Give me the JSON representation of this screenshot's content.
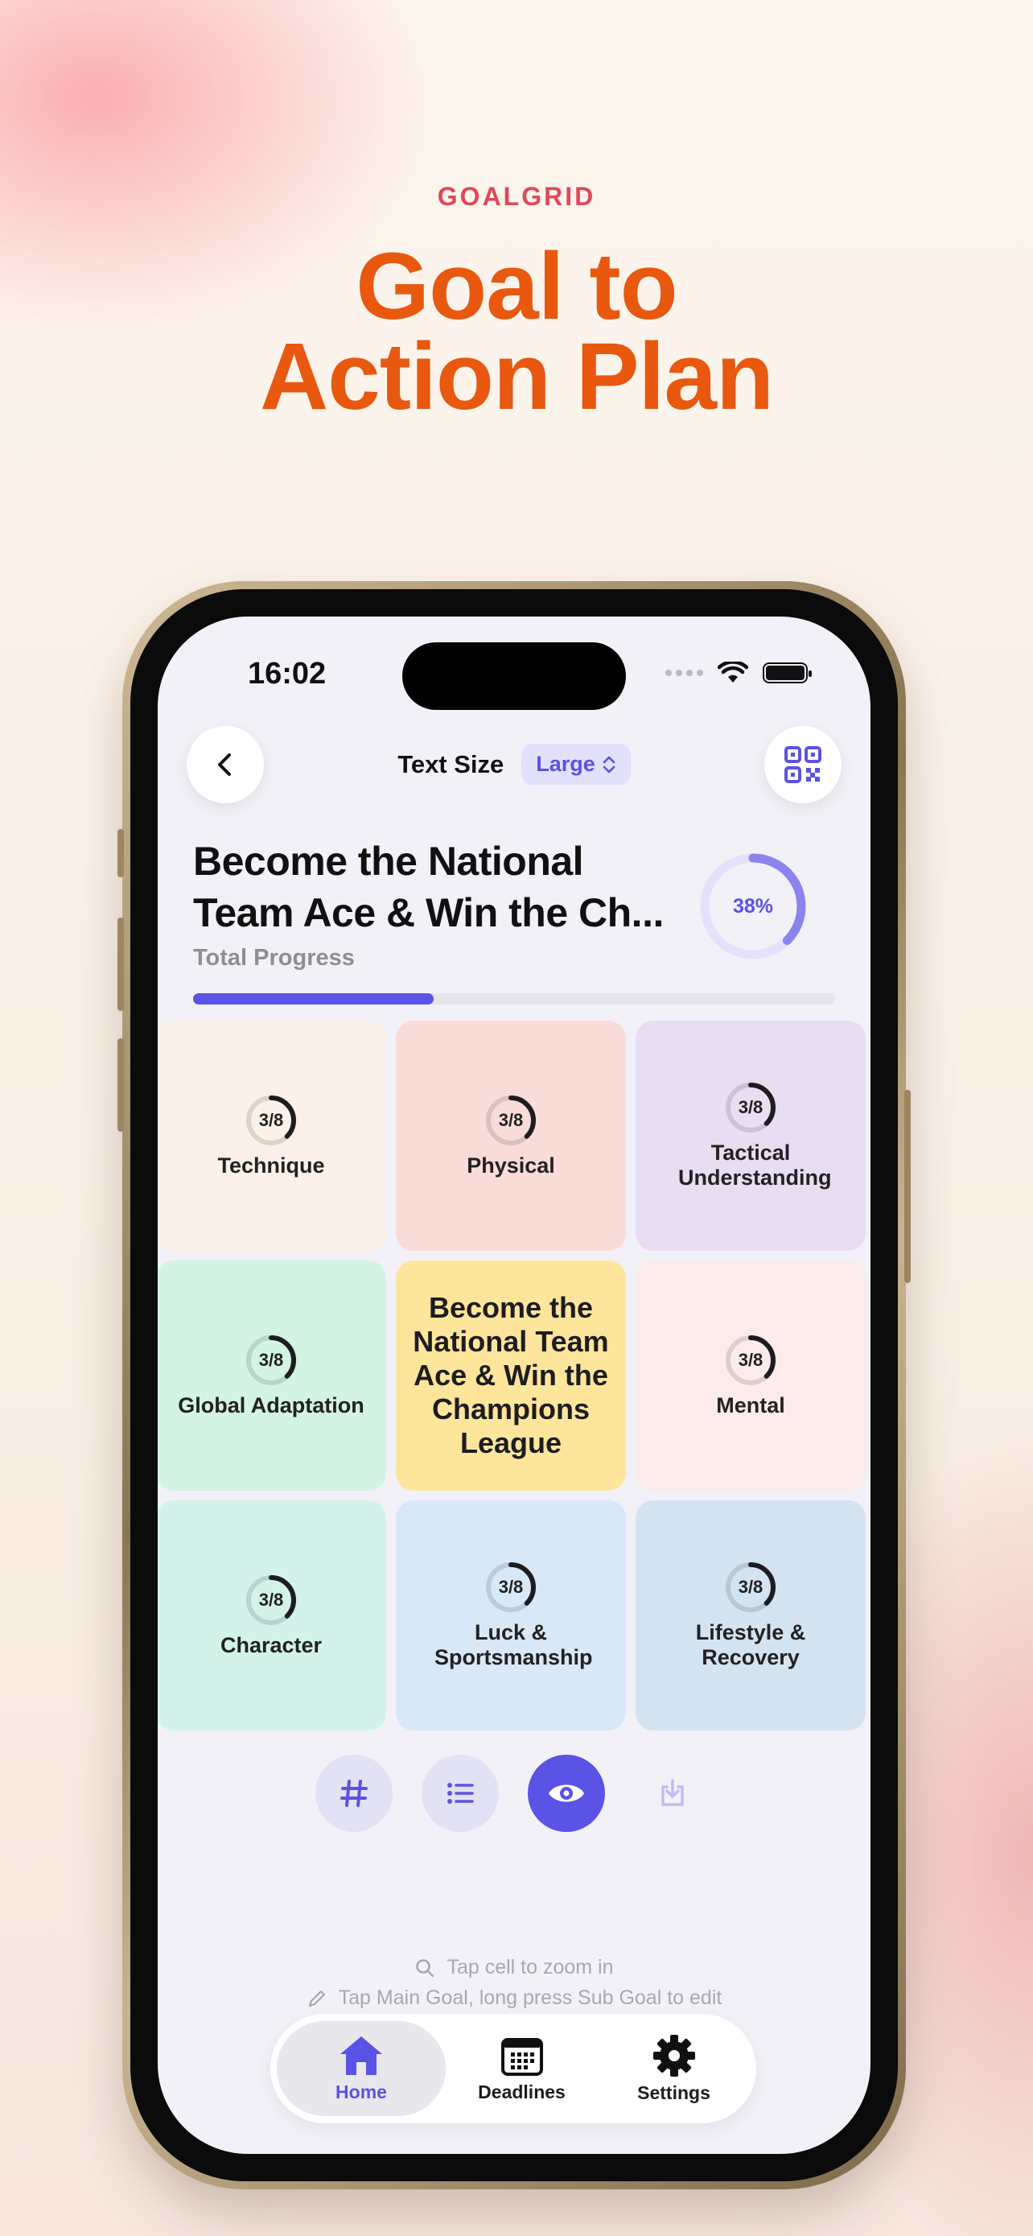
{
  "header": {
    "brand": "GOALGRID",
    "headline_line1": "Goal to",
    "headline_line2": "Action Plan"
  },
  "status_bar": {
    "time": "16:02"
  },
  "toolbar": {
    "text_size_label": "Text Size",
    "text_size_value": "Large"
  },
  "goal": {
    "title_line1": "Become the National",
    "title_line2": "Team Ace & Win the Ch...",
    "total_progress_label": "Total Progress",
    "progress_percent_text": "38%",
    "progress_fraction": 0.375
  },
  "grid": {
    "center_goal": "Become the National Team Ace & Win the Champions League",
    "cells": [
      {
        "label": "Technique",
        "progress": "3/8",
        "color": "#fcf1e8"
      },
      {
        "label": "Physical",
        "progress": "3/8",
        "color": "#f9dcd8"
      },
      {
        "label": "Tactical Understanding",
        "progress": "3/8",
        "color": "#e9ddf1"
      },
      {
        "label": "Global Adaptation",
        "progress": "3/8",
        "color": "#d3f3e3"
      },
      {
        "label": "Mental",
        "progress": "3/8",
        "color": "#fcebeb"
      },
      {
        "label": "Character",
        "progress": "3/8",
        "color": "#d3f2ea"
      },
      {
        "label": "Luck & Sportsmanship",
        "progress": "3/8",
        "color": "#d8e8f7"
      },
      {
        "label": "Lifestyle & Recovery",
        "progress": "3/8",
        "color": "#d3e3f0"
      }
    ],
    "center_color": "#fde59b"
  },
  "tools": [
    "hashtag-icon",
    "list-icon",
    "eye-icon",
    "download-icon"
  ],
  "hints": {
    "zoom": "Tap cell to zoom in",
    "edit": "Tap Main Goal, long press Sub Goal to edit"
  },
  "tabbar": {
    "home": "Home",
    "deadlines": "Deadlines",
    "settings": "Settings"
  },
  "colors": {
    "accent": "#5b52e6",
    "headline": "#e8580f",
    "brand": "#e0485a"
  }
}
